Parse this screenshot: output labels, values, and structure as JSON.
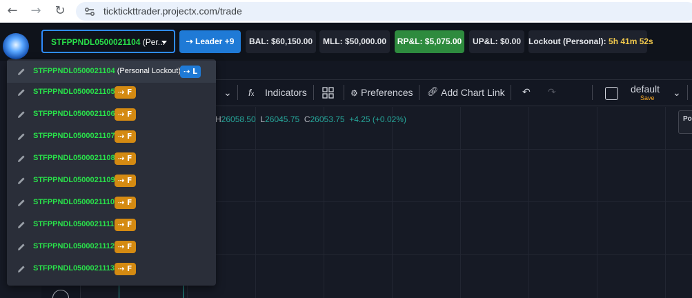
{
  "browser": {
    "url": "ticktickttrader.projectx.com/trade",
    "back_icon": "arrow-left-icon",
    "forward_icon": "arrow-right-icon",
    "reload_icon": "reload-icon"
  },
  "header": {
    "account_select": {
      "account": "STFPPNDL0500021104",
      "suffix": " (Per...",
      "icon": "chevron-down-icon"
    },
    "leader_label": "Leader +9",
    "bal": "BAL: $60,150.00",
    "mll": "MLL: $50,000.00",
    "rpl": "RP&L: $5,075.00",
    "upl": "UP&L: $0.00",
    "lockout_label": "Lockout (Personal): ",
    "lockout_time": "5h 41m 52s"
  },
  "toolbar": {
    "indicators": "Indicators",
    "preferences": "Preferences",
    "add_chart_link": "Add Chart Link",
    "default_label": "default",
    "save_label": "Save"
  },
  "chart": {
    "high_label": "H",
    "high": "26058.50",
    "low_label": "L",
    "low": "26045.75",
    "close_label": "C",
    "close": "26053.75",
    "change": "+4.25 (+0.02%)",
    "side_panel_label": "Po"
  },
  "dropdown": {
    "items": [
      {
        "account": "STFPPNDL0500021104",
        "suffix": " (Personal Lockout)",
        "badge": "L",
        "badge_type": "leader"
      },
      {
        "account": "STFPPNDL0500021105",
        "suffix": "",
        "badge": "F",
        "badge_type": "follower"
      },
      {
        "account": "STFPPNDL0500021106",
        "suffix": "",
        "badge": "F",
        "badge_type": "follower"
      },
      {
        "account": "STFPPNDL0500021107",
        "suffix": "",
        "badge": "F",
        "badge_type": "follower"
      },
      {
        "account": "STFPPNDL0500021108",
        "suffix": "",
        "badge": "F",
        "badge_type": "follower"
      },
      {
        "account": "STFPPNDL0500021109",
        "suffix": "",
        "badge": "F",
        "badge_type": "follower"
      },
      {
        "account": "STFPPNDL0500021110",
        "suffix": "",
        "badge": "F",
        "badge_type": "follower"
      },
      {
        "account": "STFPPNDL0500021111",
        "suffix": "",
        "badge": "F",
        "badge_type": "follower"
      },
      {
        "account": "STFPPNDL0500021112",
        "suffix": "",
        "badge": "F",
        "badge_type": "follower"
      },
      {
        "account": "STFPPNDL0500021113",
        "suffix": "",
        "badge": "F",
        "badge_type": "follower"
      }
    ]
  },
  "colors": {
    "account_green": "#29e14a",
    "leader_blue": "#1f7ad6",
    "follower_orange": "#d48a12",
    "rpl_green": "#2e8b3e",
    "lockout_yellow": "#f2c94c"
  }
}
